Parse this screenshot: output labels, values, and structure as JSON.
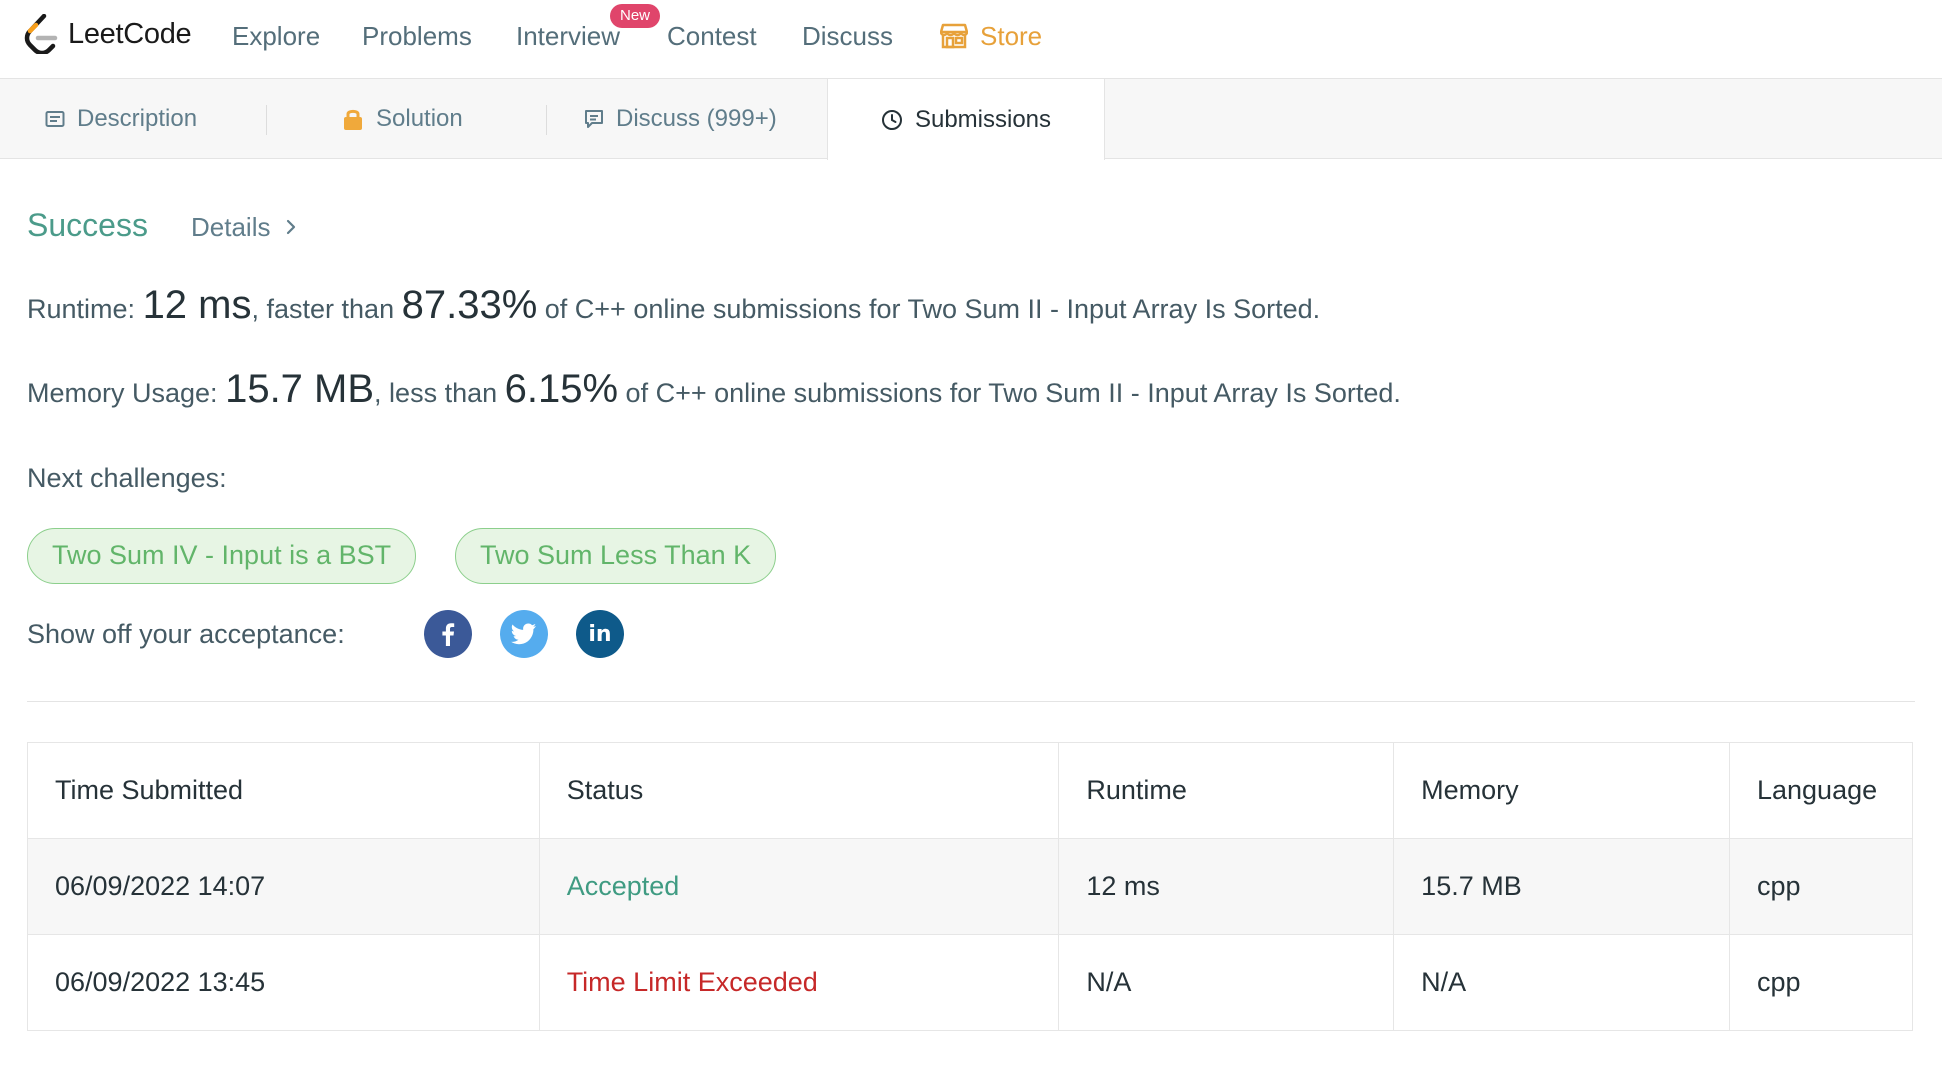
{
  "brand": {
    "name": "LeetCode"
  },
  "nav": {
    "items": [
      {
        "label": "Explore"
      },
      {
        "label": "Problems"
      },
      {
        "label": "Interview"
      },
      {
        "label": "Contest"
      },
      {
        "label": "Discuss"
      }
    ],
    "new_badge": "New",
    "store": "Store"
  },
  "tabs": [
    {
      "label": "Description"
    },
    {
      "label": "Solution"
    },
    {
      "label": "Discuss (999+)"
    },
    {
      "label": "Submissions",
      "active": true
    }
  ],
  "result": {
    "status": "Success",
    "details_link": "Details"
  },
  "runtime": {
    "label": "Runtime:",
    "value": "12 ms",
    "comparison": ", faster than ",
    "percent": "87.33%",
    "suffix": " of C++ online submissions for Two Sum II - Input Array Is Sorted."
  },
  "memory": {
    "label": "Memory Usage:",
    "value": "15.7 MB",
    "comparison": ", less than ",
    "percent": "6.15%",
    "suffix": " of C++ online submissions for Two Sum II - Input Array Is Sorted."
  },
  "next_challenges": {
    "label": "Next challenges:",
    "items": [
      {
        "label": "Two Sum IV - Input is a BST"
      },
      {
        "label": "Two Sum Less Than K"
      }
    ]
  },
  "share": {
    "label": "Show off your acceptance:",
    "icons": [
      "facebook-icon",
      "twitter-icon",
      "linkedin-icon"
    ]
  },
  "submissions": {
    "columns": [
      "Time Submitted",
      "Status",
      "Runtime",
      "Memory",
      "Language"
    ],
    "rows": [
      {
        "time": "06/09/2022 14:07",
        "status": "Accepted",
        "runtime": "12 ms",
        "memory": "15.7 MB",
        "language": "cpp"
      },
      {
        "time": "06/09/2022 13:45",
        "status": "Time Limit Exceeded",
        "runtime": "N/A",
        "memory": "N/A",
        "language": "cpp"
      }
    ]
  },
  "colors": {
    "success": "#4b9b8a",
    "accepted": "#3f9b82",
    "error": "#c62828",
    "store": "#e7a13a",
    "badge": "#e0456b",
    "chip_bg": "#e7f5e4",
    "chip_text": "#62b56a"
  }
}
